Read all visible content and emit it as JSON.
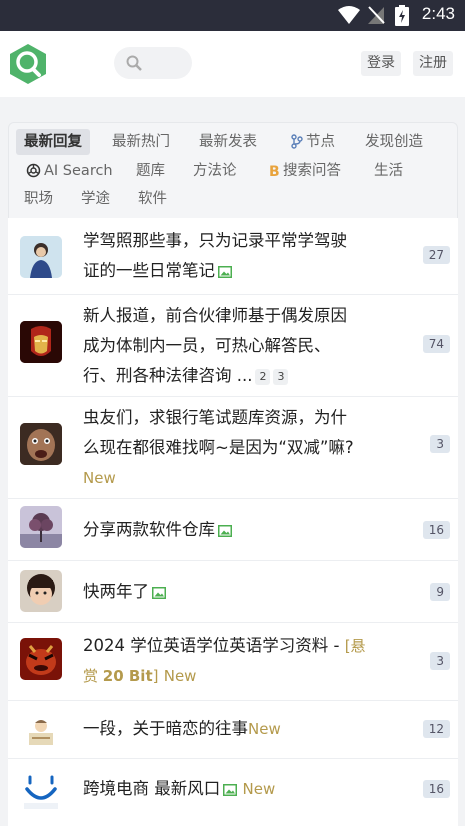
{
  "status": {
    "time": "2:43"
  },
  "header": {
    "login": "登录",
    "register": "注册"
  },
  "tabs": [
    "最新回复",
    "最新热门",
    "最新发表",
    "节点",
    "发现创造",
    "AI Search",
    "题库",
    "方法论",
    "搜索问答",
    "生活",
    "职场",
    "学途",
    "软件"
  ],
  "topics": [
    {
      "line1": "学驾照那些事，只为记录平常学驾驶",
      "line2": "证的一些日常笔记",
      "count": "27"
    },
    {
      "line1": "新人报道，前合伙律师基于偶发原因",
      "line2": "成为体制内一员，可热心解答民、",
      "line3": "行、刑各种法律咨询 ...",
      "page2": "2",
      "page3": "3",
      "count": "74"
    },
    {
      "line1": "虫友们，求银行笔试题库资源，为什",
      "line2": "么现在都很难找啊~是因为“双减”嘛?",
      "new": "New",
      "count": "3"
    },
    {
      "line1": "分享两款软件仓库",
      "count": "16"
    },
    {
      "line1": "快两年了",
      "count": "9"
    },
    {
      "line1": "2024 学位英语学位英语学习资料 - ",
      "bounty_open": "[悬",
      "bounty_pre": "赏 ",
      "bounty_amount": "20 Bit",
      "bounty_close": "]",
      "new": "New",
      "count": "3"
    },
    {
      "line1": "一段，关于暗恋的往事",
      "new": "New",
      "count": "12"
    },
    {
      "line1": "跨境电商 最新风口",
      "new": "New",
      "count": "16"
    }
  ],
  "colors": {
    "statusbar": "#2b2d3a",
    "logo_green": "#4fb36a",
    "new_text": "#b49a4c",
    "count_bg": "#dfe6ee"
  }
}
